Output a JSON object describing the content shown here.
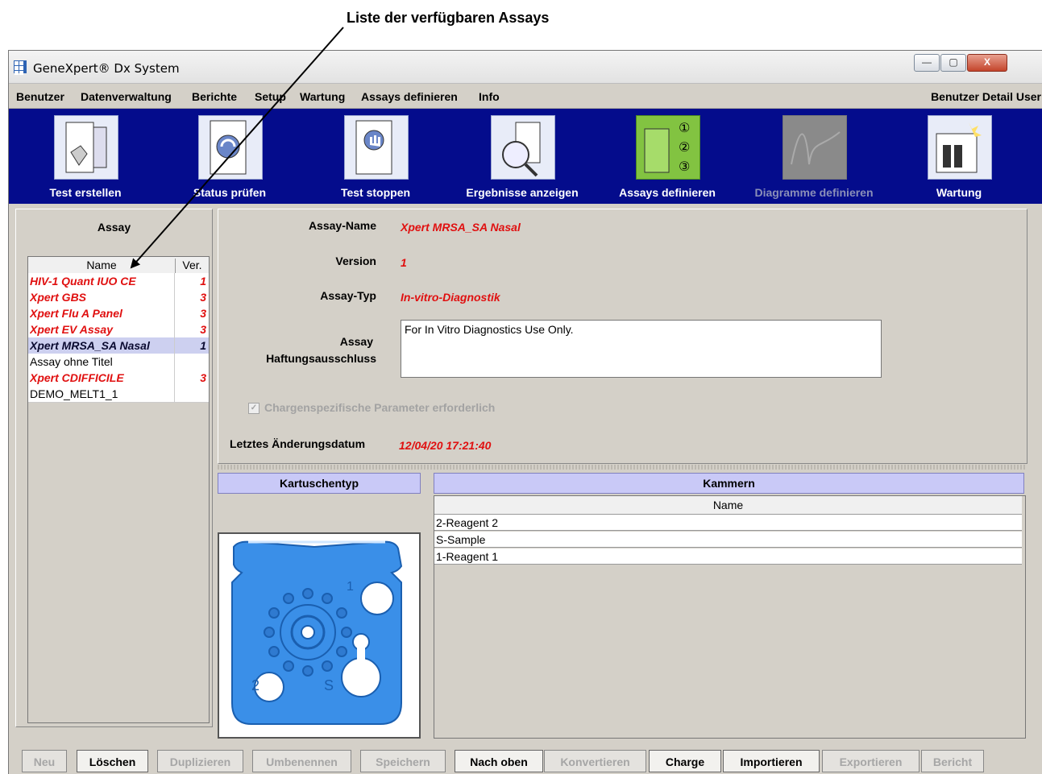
{
  "callout": {
    "text": "Liste der verfügbaren Assays"
  },
  "window": {
    "title": "GeneXpert® Dx System",
    "buttons": {
      "minimize": "—",
      "maximize": "▢",
      "close": "X"
    }
  },
  "menubar": {
    "items": [
      "Benutzer",
      "Datenverwaltung",
      "Berichte",
      "Setup",
      "Wartung",
      "Assays definieren",
      "Info"
    ],
    "user": "Benutzer Detail User"
  },
  "toolbar": {
    "items": [
      {
        "label": "Test erstellen",
        "state": "enabled"
      },
      {
        "label": "Status prüfen",
        "state": "enabled"
      },
      {
        "label": "Test stoppen",
        "state": "enabled"
      },
      {
        "label": "Ergebnisse anzeigen",
        "state": "enabled"
      },
      {
        "label": "Assays definieren",
        "state": "active"
      },
      {
        "label": "Diagramme definieren",
        "state": "disabled"
      },
      {
        "label": "Wartung",
        "state": "enabled"
      }
    ],
    "active_icon_numbers": [
      "①",
      "②",
      "③"
    ]
  },
  "assay_panel": {
    "title": "Assay",
    "columns": {
      "name": "Name",
      "ver": "Ver."
    },
    "rows": [
      {
        "name": "HIV-1 Quant IUO CE",
        "ver": "1",
        "style": "red"
      },
      {
        "name": "Xpert GBS",
        "ver": "3",
        "style": "red"
      },
      {
        "name": "Xpert Flu A Panel",
        "ver": "3",
        "style": "red"
      },
      {
        "name": "Xpert EV Assay",
        "ver": "3",
        "style": "red"
      },
      {
        "name": "Xpert MRSA_SA Nasal",
        "ver": "1",
        "style": "selected"
      },
      {
        "name": "Assay ohne Titel",
        "ver": "",
        "style": "normal"
      },
      {
        "name": "Xpert CDIFFICILE",
        "ver": "3",
        "style": "red"
      },
      {
        "name": "DEMO_MELT1_1",
        "ver": "",
        "style": "normal"
      }
    ]
  },
  "detail": {
    "assay_name_label": "Assay-Name",
    "assay_name": "Xpert MRSA_SA Nasal",
    "version_label": "Version",
    "version": "1",
    "type_label": "Assay-Typ",
    "type": "In-vitro-Diagnostik",
    "disclaimer_label_line1": "Assay",
    "disclaimer_label_line2": "Haftungsausschluss",
    "disclaimer": "For In Vitro Diagnostics Use Only.",
    "checkbox_label": "Chargenspezifische Parameter erforderlich",
    "checkbox_mark": "✓",
    "modified_label": "Letztes Änderungsdatum",
    "modified": "12/04/20 17:21:40"
  },
  "cartridge": {
    "header": "Kartuschentyp",
    "chamber_labels": [
      "1",
      "2",
      "S"
    ]
  },
  "chambers": {
    "header": "Kammern",
    "column": "Name",
    "rows": [
      "2-Reagent 2",
      "S-Sample",
      "1-Reagent 1"
    ]
  },
  "buttons": [
    {
      "label": "Neu",
      "enabled": false
    },
    {
      "label": "Löschen",
      "enabled": true
    },
    {
      "label": "Duplizieren",
      "enabled": false
    },
    {
      "label": "Umbenennen",
      "enabled": false
    },
    {
      "label": "Speichern",
      "enabled": false
    },
    {
      "label": "Nach oben",
      "enabled": true
    },
    {
      "label": "Konvertieren",
      "enabled": false
    },
    {
      "label": "Charge",
      "enabled": true
    },
    {
      "label": "Importieren",
      "enabled": true
    },
    {
      "label": "Exportieren",
      "enabled": false
    },
    {
      "label": "Bericht",
      "enabled": false
    }
  ],
  "colors": {
    "toolbar_bg": "#040c8c",
    "highlight_red": "#e01010",
    "section_header": "#c9c9f7",
    "active_tool": "#82c341",
    "cartridge_blue": "#3a8fe8"
  }
}
